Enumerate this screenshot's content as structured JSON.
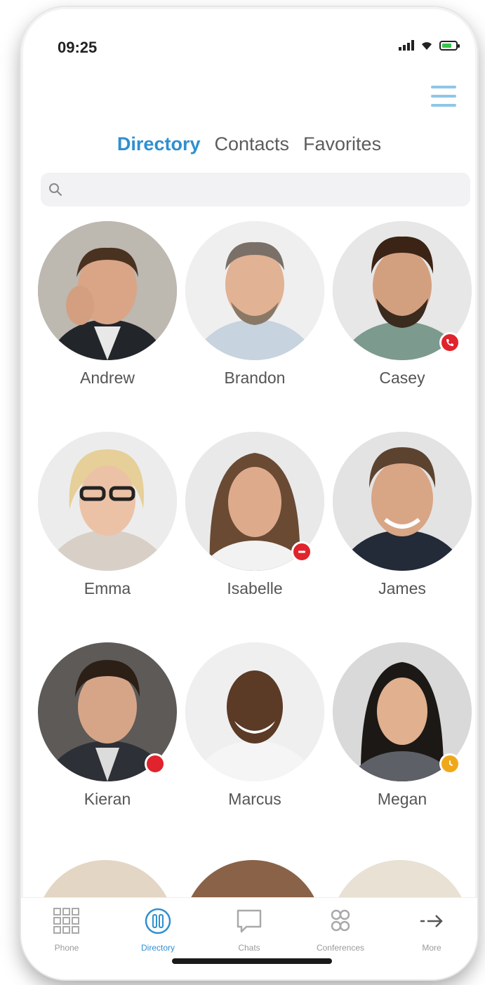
{
  "status_bar": {
    "time": "09:25"
  },
  "tabs": [
    {
      "label": "Directory",
      "active": true
    },
    {
      "label": "Contacts",
      "active": false
    },
    {
      "label": "Favorites",
      "active": false
    }
  ],
  "search": {
    "placeholder": "",
    "value": ""
  },
  "contacts": [
    {
      "name": "Andrew",
      "status": null
    },
    {
      "name": "Brandon",
      "status": null
    },
    {
      "name": "Casey",
      "status": "on-call"
    },
    {
      "name": "Emma",
      "status": null
    },
    {
      "name": "Isabelle",
      "status": "do-not-disturb"
    },
    {
      "name": "James",
      "status": null
    },
    {
      "name": "Kieran",
      "status": "busy"
    },
    {
      "name": "Marcus",
      "status": null
    },
    {
      "name": "Megan",
      "status": "away"
    }
  ],
  "tab_bar": [
    {
      "label": "Phone",
      "icon": "keypad-icon",
      "active": false
    },
    {
      "label": "Directory",
      "icon": "directory-icon",
      "active": true
    },
    {
      "label": "Chats",
      "icon": "chat-bubble-icon",
      "active": false
    },
    {
      "label": "Conferences",
      "icon": "conference-icon",
      "active": false
    },
    {
      "label": "More",
      "icon": "arrow-right-icon",
      "active": false
    }
  ],
  "colors": {
    "accent": "#2f8fd0",
    "status_red": "#e0232c",
    "status_amber": "#f0a81b"
  }
}
